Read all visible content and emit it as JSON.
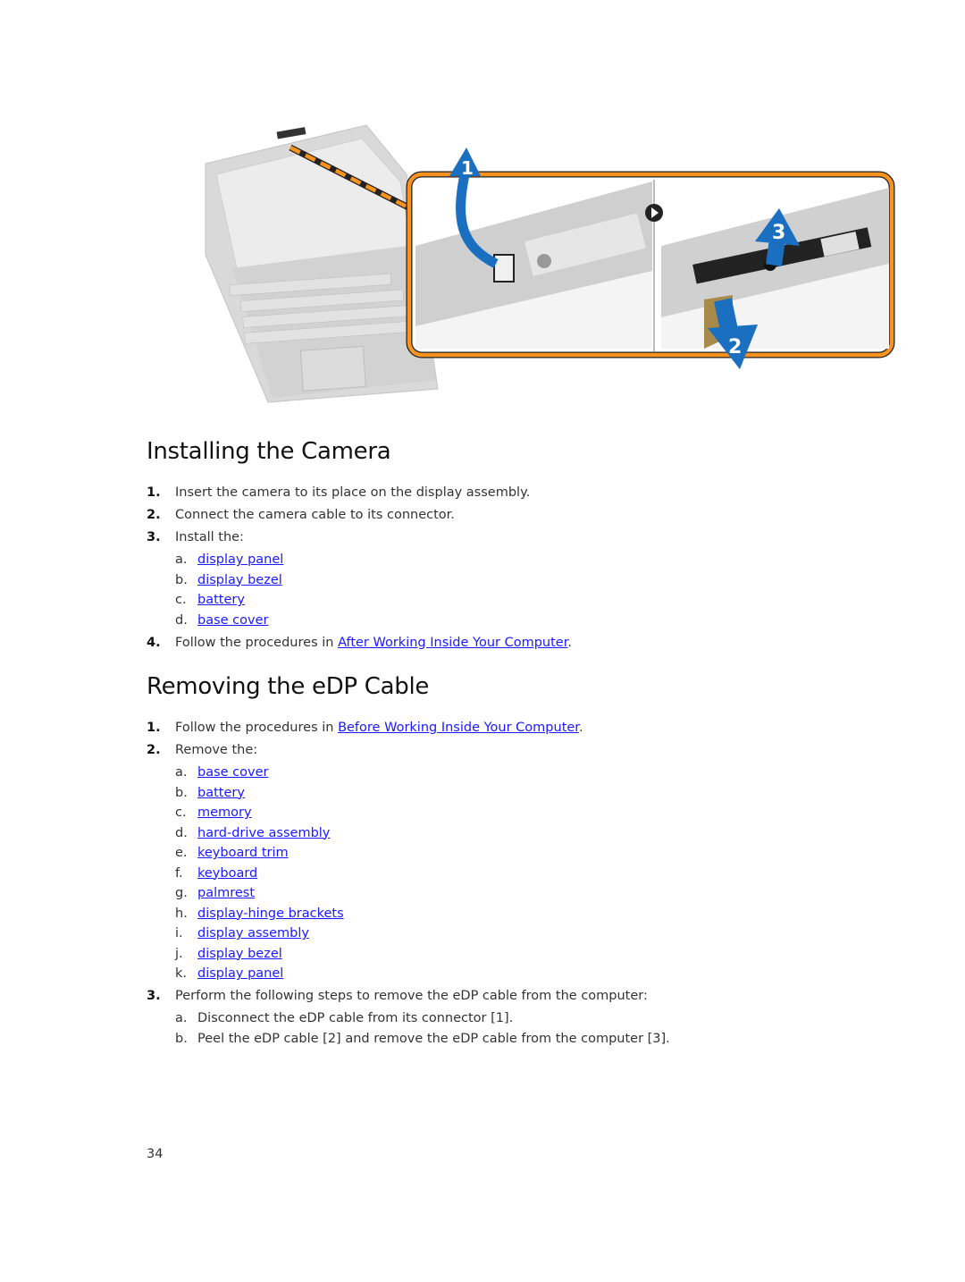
{
  "figure": {
    "callouts": [
      "1",
      "2",
      "3"
    ],
    "colors": {
      "frame": "#f7931e",
      "arrow": "#1b6fc1",
      "cable_dash": "#f7931e"
    }
  },
  "section1": {
    "title": "Installing the Camera",
    "steps": [
      {
        "num": "1.",
        "text": "Insert the camera to its place on the display assembly."
      },
      {
        "num": "2.",
        "text": "Connect the camera cable to its connector."
      },
      {
        "num": "3.",
        "text": "Install the:"
      }
    ],
    "install_items": [
      {
        "letter": "a.",
        "label": "display panel"
      },
      {
        "letter": "b.",
        "label": "display bezel"
      },
      {
        "letter": "c.",
        "label": "battery"
      },
      {
        "letter": "d.",
        "label": "base cover"
      }
    ],
    "step4": {
      "num": "4.",
      "prefix": "Follow the procedures in ",
      "link": "After Working Inside Your Computer",
      "suffix": "."
    }
  },
  "section2": {
    "title": "Removing the eDP Cable",
    "step1": {
      "num": "1.",
      "prefix": "Follow the procedures in ",
      "link": "Before Working Inside Your Computer",
      "suffix": "."
    },
    "step2": {
      "num": "2.",
      "text": "Remove the:"
    },
    "remove_items": [
      {
        "letter": "a.",
        "label": "base cover"
      },
      {
        "letter": "b.",
        "label": "battery"
      },
      {
        "letter": "c.",
        "label": "memory"
      },
      {
        "letter": "d.",
        "label": "hard-drive assembly"
      },
      {
        "letter": "e.",
        "label": "keyboard trim"
      },
      {
        "letter": "f.",
        "label": "keyboard"
      },
      {
        "letter": "g.",
        "label": "palmrest"
      },
      {
        "letter": "h.",
        "label": "display-hinge brackets"
      },
      {
        "letter": "i.",
        "label": "display assembly"
      },
      {
        "letter": "j.",
        "label": "display bezel"
      },
      {
        "letter": "k.",
        "label": "display panel"
      }
    ],
    "step3": {
      "num": "3.",
      "text": "Perform the following steps to remove the eDP cable from the computer:"
    },
    "step3_substeps": [
      {
        "letter": "a.",
        "text": "Disconnect the eDP cable from its connector [1]."
      },
      {
        "letter": "b.",
        "text": "Peel the eDP cable [2] and remove the eDP cable from the computer [3]."
      }
    ]
  },
  "footer": {
    "page_number": "34"
  }
}
